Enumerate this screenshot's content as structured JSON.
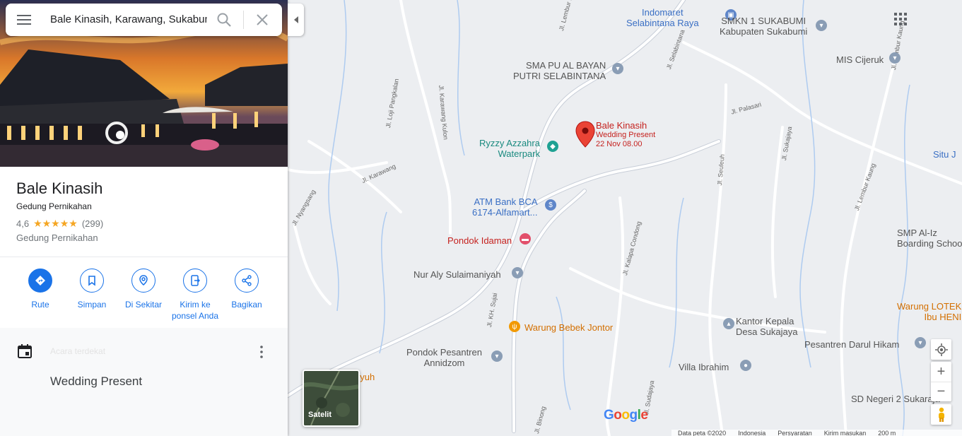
{
  "search": {
    "value": "Bale Kinasih, Karawang, Sukabumi"
  },
  "place": {
    "name": "Bale Kinasih",
    "category": "Gedung Pernikahan",
    "rating": "4,6",
    "stars": "★★★★★",
    "rating_value": 4.6,
    "reviews": "(299)",
    "category_secondary": "Gedung Pernikahan"
  },
  "actions": [
    {
      "label": "Rute",
      "icon": "directions-icon"
    },
    {
      "label": "Simpan",
      "icon": "bookmark-icon"
    },
    {
      "label": "Di Sekitar",
      "icon": "nearby-icon"
    },
    {
      "label": "Kirim ke ponsel Anda",
      "icon": "send-to-phone-icon"
    },
    {
      "label": "Bagikan",
      "icon": "share-icon"
    }
  ],
  "event": {
    "title": "Wedding Present",
    "faint": "Acara terdekat"
  },
  "map": {
    "marker": {
      "name": "Bale Kinasih",
      "line1": "Wedding Present",
      "line2": "22 Nov 08.00"
    },
    "pois": [
      {
        "name": "Indomaret\nSelabintana Raya",
        "icon": "shopping-icon"
      },
      {
        "name": "SMKN 1 SUKABUMI\nKabupaten Sukabumi",
        "icon": "school-icon"
      },
      {
        "name": "SMA PU AL BAYAN\nPUTRI SELABINTANA",
        "icon": "school-icon"
      },
      {
        "name": "MIS Cijeruk",
        "icon": "school-icon"
      },
      {
        "name": "Ryzzy Azzahra\nWaterpark",
        "icon": "park-icon"
      },
      {
        "name": "Situ J",
        "icon": ""
      },
      {
        "name": "ATM Bank BCA\n6174-Alfamart...",
        "icon": "atm-icon"
      },
      {
        "name": "Pondok Idaman",
        "icon": "hotel-icon"
      },
      {
        "name": "Nur Aly Sulaimaniyah",
        "icon": "school-icon"
      },
      {
        "name": "SMP Al-Iz\nBoarding Schoo",
        "icon": ""
      },
      {
        "name": "Warung LOTEK\nIbu HENI",
        "icon": ""
      },
      {
        "name": "Kantor Kepala\nDesa Sukajaya",
        "icon": "government-icon"
      },
      {
        "name": "Warung Bebek Jontor",
        "icon": "restaurant-icon"
      },
      {
        "name": "Pesantren Darul Hikam",
        "icon": "school-icon"
      },
      {
        "name": "Pondok Pesantren\nAnnidzom",
        "icon": "school-icon"
      },
      {
        "name": "Villa Ibrahim",
        "icon": "place-icon"
      },
      {
        "name": "uyuh",
        "icon": ""
      },
      {
        "name": "SD Negeri 2 Sukaraja",
        "icon": ""
      }
    ],
    "roads": [
      "Jl. Lembur Pasir",
      "Jl. Selabintana",
      "Jl. Loji Pangkalan",
      "Jl. Karawang Kulon",
      "Jl. Palasari",
      "Jl. Sukajaya",
      "Jl. Lembur Kaung",
      "Jl. Karawang",
      "Jl. Nyangsang",
      "Jl. Seuleuh",
      "Jl. Lembur Kaung",
      "Jl. Kalapa Condong",
      "Jl. KH. Sujai",
      "Jl. Sudajaya",
      "Jl. Binong"
    ],
    "satellite_label": "Satelit",
    "logo": "Google",
    "footer": [
      "Data peta ©2020",
      "Indonesia",
      "Persyaratan",
      "Kirim masukan",
      "200 m"
    ]
  }
}
